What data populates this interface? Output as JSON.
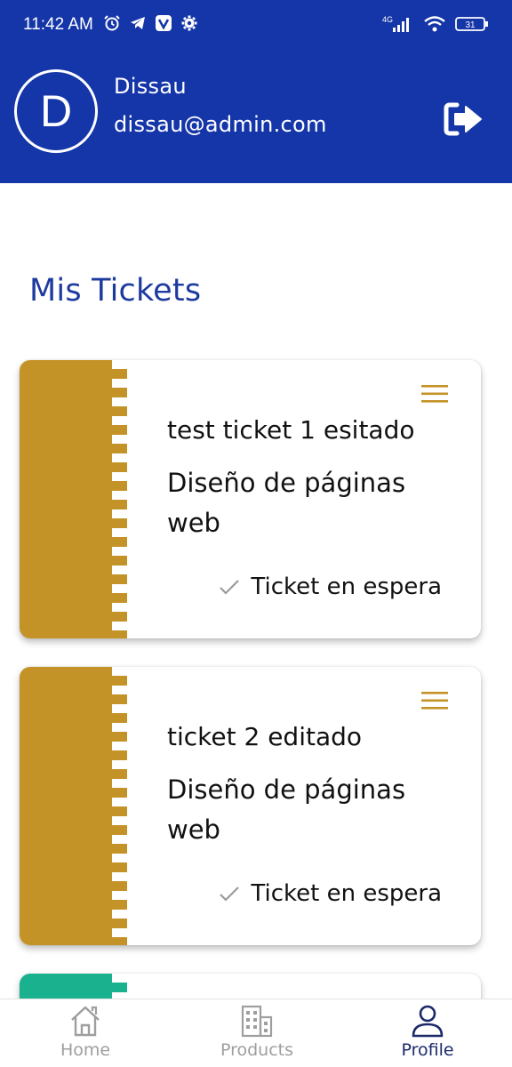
{
  "status_bar": {
    "time": "11:42 AM",
    "battery": "31",
    "network": "4G"
  },
  "header": {
    "avatar_initial": "D",
    "user_name": "Dissau",
    "user_email": "dissau@admin.com",
    "logout_icon": "logout-icon"
  },
  "section": {
    "title": "Mis Tickets"
  },
  "tickets": [
    {
      "title": "test ticket 1 esitado",
      "service": "Diseño de páginas web",
      "status": "Ticket en espera",
      "stub_color": "#c49327"
    },
    {
      "title": "ticket 2 editado",
      "service": "Diseño de páginas web",
      "status": "Ticket en espera",
      "stub_color": "#c49327"
    },
    {
      "title": "",
      "service": "",
      "status": "",
      "stub_color": "#1ab28e"
    }
  ],
  "bottom_nav": {
    "items": [
      {
        "label": "Home",
        "icon": "home-icon",
        "active": false
      },
      {
        "label": "Products",
        "icon": "building-icon",
        "active": false
      },
      {
        "label": "Profile",
        "icon": "person-icon",
        "active": true
      }
    ]
  },
  "colors": {
    "primary": "#1536a8",
    "title_blue": "#1d3a9e",
    "ticket_gold": "#c49327",
    "ticket_green": "#1ab28e",
    "nav_active": "#1b2a6b",
    "nav_inactive": "#9e9e9e"
  }
}
